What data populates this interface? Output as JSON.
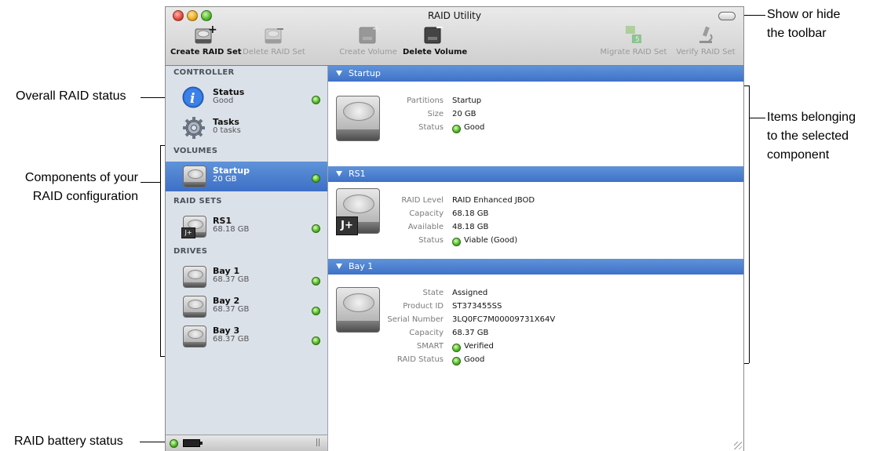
{
  "window": {
    "title": "RAID Utility"
  },
  "toolbar": {
    "buttons": [
      {
        "label": "Create RAID Set",
        "enabled": true,
        "icon": "drive-plus-icon"
      },
      {
        "label": "Delete RAID Set",
        "enabled": false,
        "icon": "drive-minus-icon"
      },
      {
        "label": "Create Volume",
        "enabled": false,
        "icon": "volume-plus-icon"
      },
      {
        "label": "Delete Volume",
        "enabled": true,
        "icon": "volume-minus-icon"
      },
      {
        "label": "Migrate RAID Set",
        "enabled": false,
        "icon": "migrate-icon"
      },
      {
        "label": "Verify RAID Set",
        "enabled": false,
        "icon": "microscope-icon"
      }
    ]
  },
  "sidebar": {
    "controller_heading": "CONTROLLER",
    "volumes_heading": "VOLUMES",
    "raidsets_heading": "RAID SETS",
    "drives_heading": "DRIVES",
    "status": {
      "title": "Status",
      "sub": "Good"
    },
    "tasks": {
      "title": "Tasks",
      "sub": "0 tasks"
    },
    "startup": {
      "title": "Startup",
      "sub": "20 GB"
    },
    "rs1": {
      "title": "RS1",
      "sub": "68.18 GB",
      "badge": "J+"
    },
    "bay1": {
      "title": "Bay 1",
      "sub": "68.37 GB"
    },
    "bay2": {
      "title": "Bay 2",
      "sub": "68.37 GB"
    },
    "bay3": {
      "title": "Bay 3",
      "sub": "68.37 GB"
    }
  },
  "content": {
    "startup": {
      "heading": "Startup",
      "partitions_k": "Partitions",
      "partitions_v": "Startup",
      "size_k": "Size",
      "size_v": "20 GB",
      "status_k": "Status",
      "status_v": "Good"
    },
    "rs1": {
      "heading": "RS1",
      "level_k": "RAID Level",
      "level_v": "RAID Enhanced JBOD",
      "capacity_k": "Capacity",
      "capacity_v": "68.18 GB",
      "available_k": "Available",
      "available_v": "48.18 GB",
      "status_k": "Status",
      "status_v": "Viable (Good)",
      "badge": "J+"
    },
    "bay1": {
      "heading": "Bay 1",
      "state_k": "State",
      "state_v": "Assigned",
      "product_k": "Product ID",
      "product_v": "ST373455SS",
      "serial_k": "Serial Number",
      "serial_v": "3LQ0FC7M00009731X64V",
      "capacity_k": "Capacity",
      "capacity_v": "68.37 GB",
      "smart_k": "SMART",
      "smart_v": "Verified",
      "raidstatus_k": "RAID Status",
      "raidstatus_v": "Good"
    }
  },
  "callouts": {
    "toolbar": [
      "Show or hide",
      "the toolbar"
    ],
    "overall": "Overall RAID status",
    "components": [
      "Components of your",
      "RAID configuration"
    ],
    "items": [
      "Items belonging",
      "to the selected",
      "component"
    ],
    "battery": "RAID battery status"
  },
  "colors": {
    "selection": "#4a7fd0",
    "status_green": "#49b523",
    "sidebar_bg": "#dbe1e9"
  }
}
